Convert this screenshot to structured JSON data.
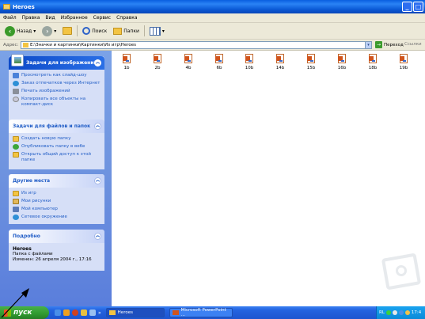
{
  "window": {
    "title": "Heroes"
  },
  "menu": [
    "Файл",
    "Правка",
    "Вид",
    "Избранное",
    "Сервис",
    "Справка"
  ],
  "toolbar": {
    "back_label": "Назад",
    "search_label": "Поиск",
    "folders_label": "Папки"
  },
  "address": {
    "label": "Адрес:",
    "path": "E:\\Значки и картинки\\Картинки\\Из игр\\Heroes",
    "go_label": "Переход",
    "links_label": "Ссылки"
  },
  "panes": {
    "image_tasks": {
      "title": "Задачи для изображений",
      "items": [
        "Просмотреть как слайд-шоу",
        "Заказ отпечатков через Интернет",
        "Печать изображений",
        "Копировать все объекты на компакт-диск"
      ]
    },
    "file_tasks": {
      "title": "Задачи для файлов и папок",
      "items": [
        "Создать новую папку",
        "Опубликовать папку в вебе",
        "Открыть общий доступ к этой папке"
      ]
    },
    "other_places": {
      "title": "Другие места",
      "items": [
        "Из игр",
        "Мои рисунки",
        "Мой компьютер",
        "Сетевое окружение"
      ]
    },
    "details": {
      "title": "Подробно",
      "name": "Heroes",
      "type": "Папка с файлами",
      "modified": "Изменен: 26 апреля 2004 г., 17:16"
    }
  },
  "files": [
    "1b",
    "2b",
    "4b",
    "6b",
    "10b",
    "14b",
    "15b",
    "16b",
    "18b",
    "19b"
  ],
  "taskbar": {
    "start_label": "пуск",
    "more_label": "»",
    "tasks": [
      {
        "label": "Heroes",
        "icon": "folder-icon"
      },
      {
        "label": "Microsoft PowerPoint ...",
        "icon": "powerpoint-icon"
      }
    ],
    "tray_lang": "RL",
    "clock": "17:4"
  }
}
